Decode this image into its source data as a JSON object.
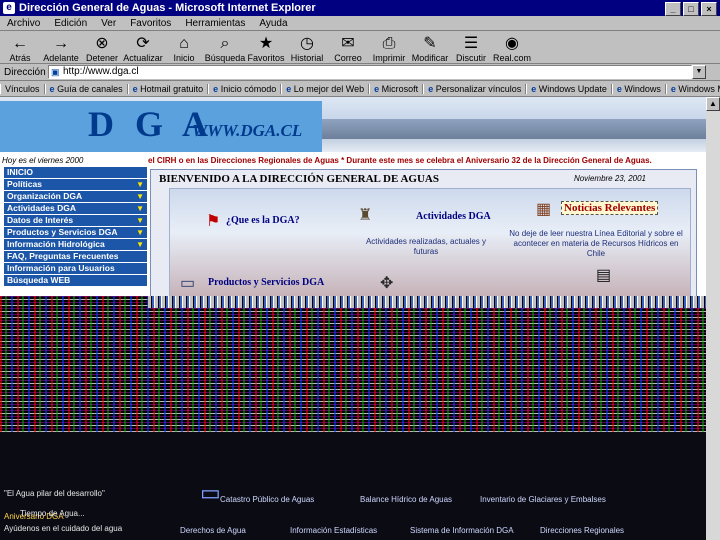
{
  "window": {
    "title": "Dirección General de Aguas - Microsoft Internet Explorer",
    "controls": [
      "_",
      "□",
      "×"
    ]
  },
  "menu": [
    "Archivo",
    "Edición",
    "Ver",
    "Favoritos",
    "Herramientas",
    "Ayuda"
  ],
  "toolbar": [
    {
      "label": "Atrás",
      "icon": "back-arrow-icon",
      "glyph": "←"
    },
    {
      "label": "Adelante",
      "icon": "forward-arrow-icon",
      "glyph": "→"
    },
    {
      "label": "Detener",
      "icon": "stop-icon",
      "glyph": "⊗"
    },
    {
      "label": "Actualizar",
      "icon": "refresh-icon",
      "glyph": "⟳"
    },
    {
      "label": "Inicio",
      "icon": "home-icon",
      "glyph": "⌂"
    },
    {
      "label": "Búsqueda",
      "icon": "search-icon",
      "glyph": "⌕"
    },
    {
      "label": "Favoritos",
      "icon": "favorites-icon",
      "glyph": "★"
    },
    {
      "label": "Historial",
      "icon": "history-icon",
      "glyph": "◷"
    },
    {
      "label": "Correo",
      "icon": "mail-icon",
      "glyph": "✉"
    },
    {
      "label": "Imprimir",
      "icon": "print-icon",
      "glyph": "⎙"
    },
    {
      "label": "Modificar",
      "icon": "edit-icon",
      "glyph": "✎"
    },
    {
      "label": "Discutir",
      "icon": "discuss-icon",
      "glyph": "☰"
    },
    {
      "label": "Real.com",
      "icon": "realplayer-icon",
      "glyph": "◉"
    }
  ],
  "address": {
    "label": "Dirección",
    "url": "http://www.dga.cl"
  },
  "links": [
    "Vínculos",
    "Guía de canales",
    "Hotmail gratuito",
    "Inicio cómodo",
    "Lo mejor del Web",
    "Microsoft",
    "Personalizar vínculos",
    "Windows Update",
    "Windows",
    "Windows Media"
  ],
  "site": {
    "logo": "D G A",
    "logo_url": "WWW.DGA.CL",
    "left_date": "Hoy es el viernes 2000",
    "marquee": "el CIRH o en las Direcciones Regionales de Aguas  *   Durante este mes se celebra el Aniversario 32 de la Dirección General de Aguas.",
    "nav": [
      {
        "label": "INICIO",
        "arrow": false
      },
      {
        "label": "Políticas",
        "arrow": true
      },
      {
        "label": "Organización DGA",
        "arrow": true
      },
      {
        "label": "Actividades DGA",
        "arrow": true
      },
      {
        "label": "Datos de Interés",
        "arrow": true
      },
      {
        "label": "Productos y Servicios DGA",
        "arrow": true
      },
      {
        "label": "Información Hidrológica",
        "arrow": true
      },
      {
        "label": "FAQ, Preguntas Frecuentes",
        "arrow": false
      },
      {
        "label": "Información para Usuarios",
        "arrow": false
      },
      {
        "label": "Búsqueda WEB",
        "arrow": false
      }
    ],
    "welcome": "BIENVENIDO A LA DIRECCIÓN GENERAL DE AGUAS",
    "content_date": "Noviembre 23, 2001",
    "cards": {
      "que_es": "¿Que es la DGA?",
      "actividades": "Actividades DGA",
      "actividades_desc": "Actividades realizadas, actuales y futuras",
      "noticias": "Noticias Relevantes",
      "noticias_desc": "No deje de leer nuestra Línea Editorial y sobre el acontecer en materia de Recursos Hídricos en Chile",
      "productos": "Productos y Servicios DGA"
    },
    "footer_left": [
      "Aniversario DGA",
      "Ayúdenos en el cuidado del agua",
      "\"El Agua pilar del desarrollo\"",
      "Tiempo de Agua..."
    ],
    "footer_links_row1": [
      "Derechos de Agua",
      "Información Estadísticas",
      "Sistema de Información DGA",
      "Direcciones Regionales"
    ],
    "footer_links_row2": [
      "Catastro Público de Aguas",
      "Balance Hídrico de Aguas",
      "Inventario de Glaciares y Embalses"
    ]
  }
}
